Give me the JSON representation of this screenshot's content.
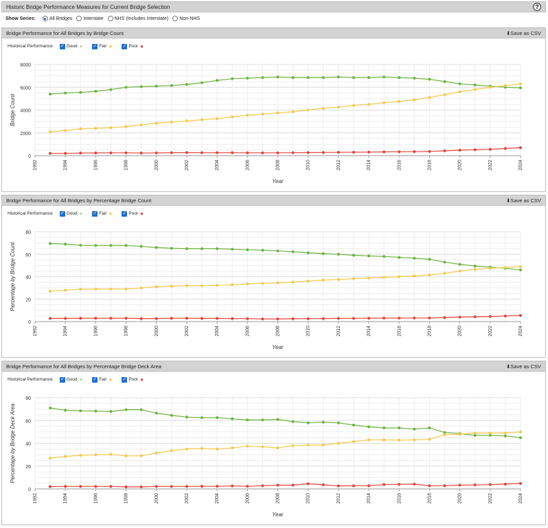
{
  "header": {
    "title": "Historic Bridge Performance Measures for Current Bridge Selection",
    "help_icon": "?"
  },
  "show_series": {
    "label": "Show Series:",
    "options": [
      {
        "label": "All Bridges",
        "selected": true
      },
      {
        "label": "Interstate",
        "selected": false
      },
      {
        "label": "NHS (Includes Interstate)",
        "selected": false
      },
      {
        "label": "Non-NHS",
        "selected": false
      }
    ]
  },
  "save_label": "Save as CSV",
  "legend": {
    "historical_label": "Historical Performance",
    "items": [
      {
        "label": "Good",
        "color": "#6cb33f"
      },
      {
        "label": "Fair",
        "color": "#f2c94c"
      },
      {
        "label": "Poor",
        "color": "#e0443c"
      }
    ]
  },
  "chart_data": [
    {
      "type": "line",
      "title": "Bridge Performance for All Bridges by Bridge Count",
      "xlabel": "Year",
      "ylabel": "Bridge Count",
      "xlim": [
        1992,
        2024
      ],
      "ylim": [
        0,
        8000
      ],
      "yticks": [
        0,
        2000,
        4000,
        6000,
        8000
      ],
      "xticks": [
        1992,
        1994,
        1996,
        1998,
        2000,
        2002,
        2004,
        2006,
        2008,
        2010,
        2012,
        2014,
        2016,
        2018,
        2020,
        2022,
        2024
      ],
      "grid": true,
      "x": [
        1993,
        1994,
        1995,
        1996,
        1997,
        1998,
        1999,
        2000,
        2001,
        2002,
        2003,
        2004,
        2005,
        2006,
        2007,
        2008,
        2009,
        2010,
        2011,
        2012,
        2013,
        2014,
        2015,
        2016,
        2017,
        2018,
        2019,
        2020,
        2021,
        2022,
        2023,
        2024
      ],
      "series": [
        {
          "name": "Good",
          "color": "#6cb33f",
          "values": [
            5400,
            5500,
            5550,
            5650,
            5800,
            6000,
            6050,
            6100,
            6150,
            6250,
            6400,
            6600,
            6750,
            6800,
            6850,
            6900,
            6850,
            6850,
            6850,
            6900,
            6850,
            6850,
            6900,
            6850,
            6800,
            6700,
            6500,
            6300,
            6200,
            6100,
            6000,
            5950
          ]
        },
        {
          "name": "Fair",
          "color": "#f2c94c",
          "values": [
            2100,
            2200,
            2350,
            2400,
            2450,
            2550,
            2700,
            2850,
            2950,
            3050,
            3150,
            3250,
            3400,
            3550,
            3650,
            3750,
            3850,
            4000,
            4150,
            4250,
            4400,
            4500,
            4650,
            4750,
            4900,
            5100,
            5350,
            5600,
            5800,
            6000,
            6150,
            6300
          ]
        },
        {
          "name": "Poor",
          "color": "#e0443c",
          "values": [
            200,
            200,
            230,
            240,
            250,
            250,
            230,
            240,
            260,
            270,
            260,
            260,
            260,
            250,
            250,
            250,
            260,
            270,
            280,
            290,
            300,
            310,
            330,
            340,
            350,
            370,
            420,
            480,
            520,
            560,
            630,
            700
          ]
        }
      ]
    },
    {
      "type": "line",
      "title": "Bridge Performance for All Bridges by Percentage Bridge Count",
      "xlabel": "Year",
      "ylabel": "Percentage by Bridge Count",
      "xlim": [
        1992,
        2024
      ],
      "ylim": [
        0,
        80
      ],
      "yticks": [
        0,
        20,
        40,
        60,
        80
      ],
      "xticks": [
        1992,
        1994,
        1996,
        1998,
        2000,
        2002,
        2004,
        2006,
        2008,
        2010,
        2012,
        2014,
        2016,
        2018,
        2020,
        2022,
        2024
      ],
      "grid": true,
      "x": [
        1993,
        1994,
        1995,
        1996,
        1997,
        1998,
        1999,
        2000,
        2001,
        2002,
        2003,
        2004,
        2005,
        2006,
        2007,
        2008,
        2009,
        2010,
        2011,
        2012,
        2013,
        2014,
        2015,
        2016,
        2017,
        2018,
        2019,
        2020,
        2021,
        2022,
        2023,
        2024
      ],
      "series": [
        {
          "name": "Good",
          "color": "#6cb33f",
          "values": [
            69.5,
            69,
            68,
            67.8,
            67.8,
            67.8,
            67,
            66,
            65.3,
            65,
            65,
            65,
            64.5,
            64,
            63.5,
            63,
            62.2,
            61.3,
            60.5,
            60,
            59,
            58.5,
            58,
            57.2,
            56.5,
            55.5,
            53,
            51,
            49.5,
            48.5,
            47.5,
            46
          ]
        },
        {
          "name": "Fair",
          "color": "#f2c94c",
          "values": [
            27,
            28,
            28.8,
            29,
            29,
            29,
            30,
            31,
            31.5,
            32,
            32,
            32.3,
            32.8,
            33.5,
            34,
            34.5,
            35.2,
            36,
            37,
            37.5,
            38.2,
            38.8,
            39.4,
            40,
            40.6,
            41.5,
            43,
            45,
            46.5,
            47.5,
            48.2,
            49
          ]
        },
        {
          "name": "Poor",
          "color": "#e0443c",
          "values": [
            2.8,
            2.8,
            3,
            3,
            3,
            3,
            2.7,
            2.7,
            3,
            3,
            2.8,
            2.8,
            2.7,
            2.6,
            2.4,
            2.4,
            2.5,
            2.6,
            2.7,
            2.8,
            2.9,
            3,
            3.1,
            3.1,
            3.2,
            3.2,
            3.6,
            4,
            4.3,
            4.6,
            5,
            5.5
          ]
        }
      ]
    },
    {
      "type": "line",
      "title": "Bridge Performance for All Bridges by Percentage Bridge Deck Area",
      "xlabel": "Year",
      "ylabel": "Percentage by Bridge Deck Area",
      "xlim": [
        1992,
        2024
      ],
      "ylim": [
        0,
        80
      ],
      "yticks": [
        0,
        20,
        40,
        60,
        80
      ],
      "xticks": [
        1992,
        1994,
        1996,
        1998,
        2000,
        2002,
        2004,
        2006,
        2008,
        2010,
        2012,
        2014,
        2016,
        2018,
        2020,
        2022,
        2024
      ],
      "grid": true,
      "x": [
        1993,
        1994,
        1995,
        1996,
        1997,
        1998,
        1999,
        2000,
        2001,
        2002,
        2003,
        2004,
        2005,
        2006,
        2007,
        2008,
        2009,
        2010,
        2011,
        2012,
        2013,
        2014,
        2015,
        2016,
        2017,
        2018,
        2019,
        2020,
        2021,
        2022,
        2023,
        2024
      ],
      "series": [
        {
          "name": "Good",
          "color": "#6cb33f",
          "values": [
            71,
            69,
            68.5,
            68.3,
            68,
            69.5,
            69.5,
            66.5,
            64.5,
            63,
            62.5,
            62.5,
            61.5,
            60.5,
            60.5,
            61,
            59,
            58,
            58.5,
            58,
            56,
            54.5,
            53.5,
            53.5,
            52.5,
            53.5,
            49.5,
            48.5,
            47,
            47,
            46.5,
            45
          ]
        },
        {
          "name": "Fair",
          "color": "#f2c94c",
          "values": [
            27,
            28.5,
            29.5,
            30,
            30.3,
            29,
            29,
            31.5,
            33.5,
            35,
            35.5,
            35,
            36,
            37.5,
            37,
            36,
            38,
            38.5,
            38.5,
            40,
            41.5,
            43,
            43,
            42.8,
            43,
            43.5,
            47.5,
            48,
            49,
            49,
            49,
            50
          ]
        },
        {
          "name": "Poor",
          "color": "#e0443c",
          "values": [
            2,
            2.2,
            2.2,
            2.2,
            2.2,
            1.8,
            1.8,
            2.2,
            2.2,
            2.2,
            2.3,
            2.3,
            2.6,
            2.3,
            2.8,
            3.3,
            3.3,
            4.5,
            3.6,
            2.6,
            2.8,
            2.8,
            3.8,
            4,
            4.2,
            2.8,
            2.8,
            3.3,
            3.5,
            3.8,
            4.2,
            4.8
          ]
        }
      ]
    }
  ]
}
